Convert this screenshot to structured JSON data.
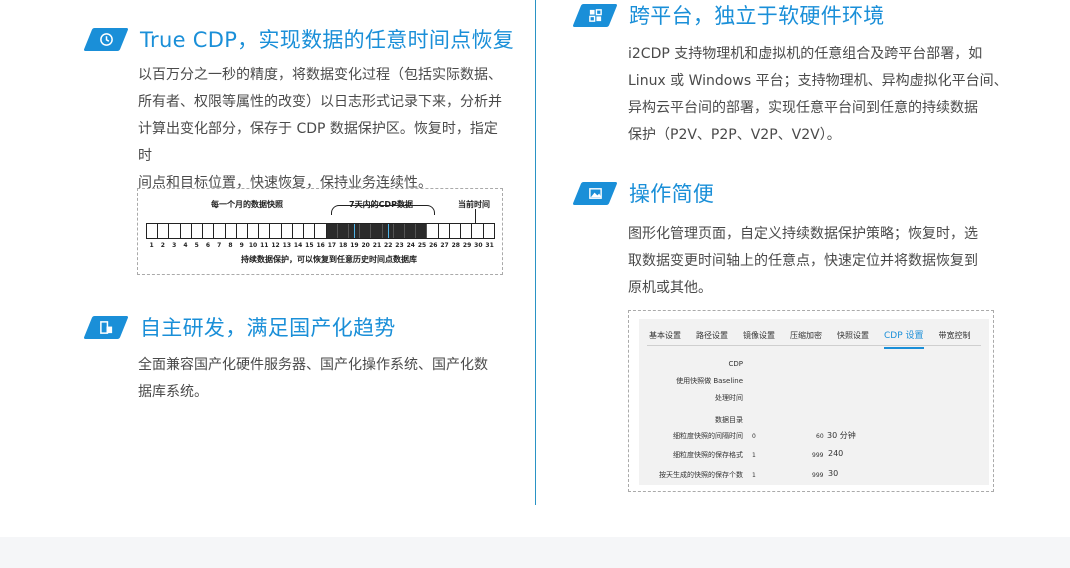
{
  "sections": {
    "true_cdp": {
      "title": "True CDP，实现数据的任意时间点恢复",
      "icon": "clock-icon",
      "body": [
        "以百万分之一秒的精度，将数据变化过程（包括实际数据、",
        "所有者、权限等属性的改变）以日志形式记录下来，分析并",
        "计算出变化部分，保存于 CDP 数据保护区。恢复时，指定时",
        "间点和目标位置，快速恢复，保持业务连续性。"
      ]
    },
    "domestic": {
      "title": "自主研发，满足国产化趋势",
      "icon": "chip-icon",
      "body": [
        "全面兼容国产化硬件服务器、国产化操作系统、国产化数",
        "据库系统。"
      ]
    },
    "cross_platform": {
      "title": "跨平台，独立于软硬件环境",
      "icon": "grid-icon",
      "body": [
        "i2CDP 支持物理机和虚拟机的任意组合及跨平台部署，如",
        "Linux 或 Windows 平台；支持物理机、异构虚拟化平台间、",
        "异构云平台间的部署，实现任意平台间到任意的持续数据",
        "保护（P2V、P2P、V2P、V2V）。"
      ]
    },
    "easy_ops": {
      "title": "操作简便",
      "icon": "image-icon",
      "body": [
        "图形化管理页面，自定义持续数据保护策略；恢复时，选",
        "取数据变更时间轴上的任意点，快速定位并将数据恢复到",
        "原机或其他。"
      ]
    }
  },
  "timeline": {
    "label_left": "每一个月的数据快照",
    "label_mid": "7天内的CDP数据",
    "label_right": "当前时间",
    "caption": "持续数据保护，可以恢复到任意历史时间点数据库",
    "days": [
      "1",
      "2",
      "3",
      "4",
      "5",
      "6",
      "7",
      "8",
      "9",
      "10",
      "11",
      "12",
      "13",
      "14",
      "15",
      "16",
      "17",
      "18",
      "19",
      "20",
      "21",
      "22",
      "23",
      "24",
      "25",
      "26",
      "27",
      "28",
      "29",
      "30",
      "31"
    ],
    "dark_from": 17,
    "dark_to": 25
  },
  "settings": {
    "tabs": [
      "基本设置",
      "路径设置",
      "镜像设置",
      "压缩加密",
      "快照设置",
      "CDP 设置",
      "带宽控制"
    ],
    "active_tab": "CDP 设置",
    "rows": {
      "cdp": "CDP",
      "baseline": "使用快照做 Baseline",
      "process_time": "处理时间",
      "data_dir": "数据目录",
      "interval": "细粒度快照的间隔时间",
      "interval_min": "0",
      "interval_max": "60",
      "interval_val": "30 分钟",
      "keep": "细粒度快照的保存格式",
      "keep_min": "1",
      "keep_max": "999",
      "keep_val": "240",
      "daily": "按天生成的快照的保存个数",
      "daily_min": "1",
      "daily_max": "999",
      "daily_val": "30"
    }
  },
  "colors": {
    "accent": "#1a8fd8",
    "divider": "#2a93c5"
  }
}
